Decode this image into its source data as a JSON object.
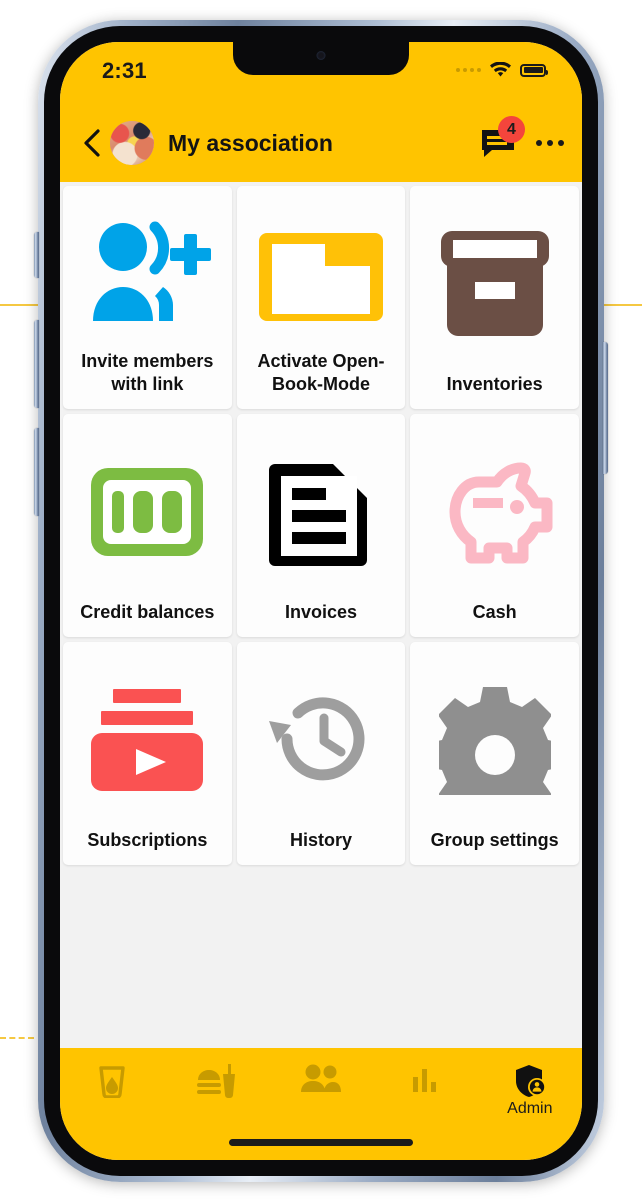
{
  "status_bar": {
    "time": "2:31",
    "signal_icon": "signal-dots-icon",
    "wifi_icon": "wifi-icon",
    "battery_icon": "battery-full-icon"
  },
  "header": {
    "back_icon": "back-chevron-icon",
    "avatar": "group-photo-avatar",
    "title": "My association",
    "chat_icon": "chat-bubble-icon",
    "chat_badge_count": "4",
    "overflow_icon": "more-options-icon"
  },
  "grid": {
    "tiles": [
      {
        "id": "invite-members",
        "label": "Invite members with link",
        "icon": "person-add-icon",
        "color": "#00a3e8"
      },
      {
        "id": "open-book-mode",
        "label": "Activate Open-Book-Mode",
        "icon": "folder-icon",
        "color": "#ffc107"
      },
      {
        "id": "inventories",
        "label": "Inventories",
        "icon": "archive-box-icon",
        "color": "#6b4f45"
      },
      {
        "id": "credit-balances",
        "label": "Credit balances",
        "icon": "banknote-100-icon",
        "color": "#7dbc42"
      },
      {
        "id": "invoices",
        "label": "Invoices",
        "icon": "document-lines-icon",
        "color": "#000000"
      },
      {
        "id": "cash",
        "label": "Cash",
        "icon": "piggy-bank-icon",
        "color": "#fbb8c4"
      },
      {
        "id": "subscriptions",
        "label": "Subscriptions",
        "icon": "video-play-icon",
        "color": "#fa5252"
      },
      {
        "id": "history",
        "label": "History",
        "icon": "history-clock-icon",
        "color": "#9e9e9e"
      },
      {
        "id": "group-settings",
        "label": "Group settings",
        "icon": "gear-icon",
        "color": "#8f8f8f"
      }
    ]
  },
  "bottom_nav": {
    "items": [
      {
        "id": "drinks",
        "label": "",
        "icon": "drink-glass-icon"
      },
      {
        "id": "food",
        "label": "",
        "icon": "burger-drink-icon"
      },
      {
        "id": "members",
        "label": "",
        "icon": "people-icon"
      },
      {
        "id": "stats",
        "label": "",
        "icon": "bar-chart-icon"
      },
      {
        "id": "admin",
        "label": "Admin",
        "icon": "shield-person-icon"
      }
    ]
  },
  "theme": {
    "accent": "#ffc400",
    "nav_icon_inactive": "#c79b00",
    "nav_icon_active": "#111111",
    "badge": "#f4453c",
    "screen_bg": "#f2f2f2"
  }
}
